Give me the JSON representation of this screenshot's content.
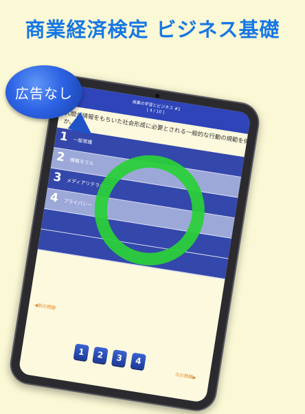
{
  "headline": "商業経済検定 ビジネス基礎",
  "badge": {
    "text": "広告なし"
  },
  "app": {
    "title": "商業の学習とビジネス #1",
    "progress": "[ 4 / 10 ]",
    "back_icon": "chevron-left-icon"
  },
  "question": {
    "line1": "人間が情報をもちいた社会形成に必要とされる一般的な行動の規範を何とい",
    "line2": "か。"
  },
  "choices": [
    {
      "num": "1",
      "label": "一般常識",
      "mark": ""
    },
    {
      "num": "2",
      "label": "情報モラル",
      "mark": ""
    },
    {
      "num": "3",
      "label": "メディアリテラシー",
      "mark": "×"
    },
    {
      "num": "4",
      "label": "プライバシー",
      "mark": "○"
    }
  ],
  "extra_marks": [
    "×",
    "×"
  ],
  "nav": {
    "prev": "◀前の問題",
    "next": "次の問題▶"
  },
  "keypad": [
    "1",
    "2",
    "3",
    "4"
  ],
  "colors": {
    "background": "#fbf8d5",
    "headline": "#1777e4",
    "bar": "#2e44b8",
    "choice": "#3447ab",
    "correct_circle": "#2bcf3a",
    "link": "#e38a2c"
  }
}
